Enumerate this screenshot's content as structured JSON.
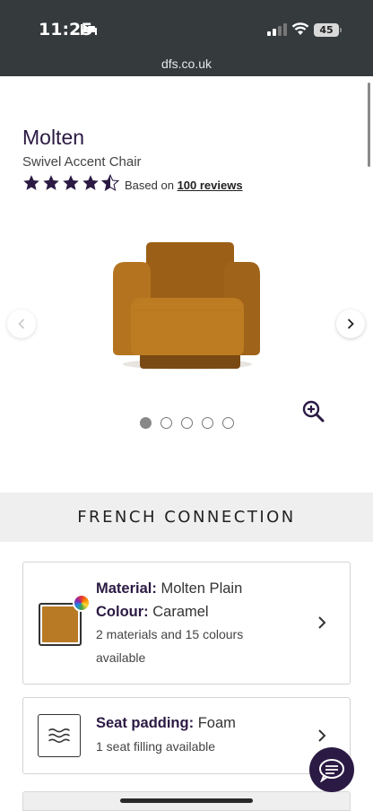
{
  "status_bar": {
    "time": "11:25",
    "battery": "45"
  },
  "browser": {
    "url": "dfs.co.uk"
  },
  "product": {
    "title": "Molten",
    "subtitle": "Swivel Accent Chair",
    "rating": 4.5,
    "rating_max": 5,
    "reviews_prefix": "Based on",
    "reviews_link": "100 reviews"
  },
  "gallery": {
    "image_count": 5,
    "active_index": 0,
    "image_icon": "armchair",
    "prev_icon": "chevron-left-icon",
    "next_icon": "chevron-right-icon",
    "zoom_icon": "zoom-in-icon"
  },
  "brand": {
    "name": "FRENCH CONNECTION"
  },
  "material_card": {
    "material_label": "Material:",
    "material_value": "Molten Plain",
    "colour_label": "Colour:",
    "colour_value": "Caramel",
    "availability": "2 materials and 15 colours available",
    "swatch_color": "#b97a25"
  },
  "seat_card": {
    "label": "Seat padding:",
    "value": "Foam",
    "availability": "1 seat filling available",
    "icon": "waves-icon"
  },
  "colors": {
    "brand_purple": "#2b1a43",
    "status_bar": "#353a3d"
  }
}
